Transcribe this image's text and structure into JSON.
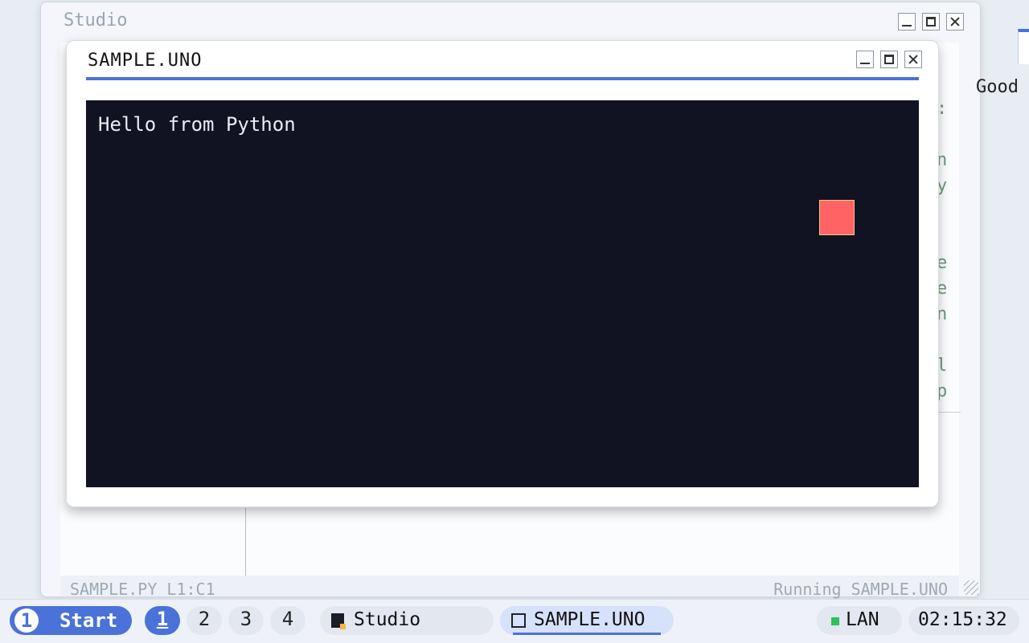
{
  "studio": {
    "title": "Studio",
    "peek_chars": [
      ":",
      "n",
      "y",
      "e",
      "e",
      "n",
      "l",
      "p"
    ],
    "status_left": "SAMPLE.PY L1:C1",
    "status_right": "Running SAMPLE.UNO"
  },
  "edge_window": {
    "text": "Good"
  },
  "uno": {
    "title": "SAMPLE.UNO",
    "canvas_text": "Hello from Python",
    "sprite_color": "#ff6363"
  },
  "taskbar": {
    "start_num": "1",
    "start_label": "Start",
    "workspaces": [
      "1",
      "2",
      "3",
      "4"
    ],
    "tasks": [
      "Studio",
      "SAMPLE.UNO"
    ],
    "network": "LAN",
    "clock": "02:15:32"
  },
  "colors": {
    "accent": "#4a72d8",
    "canvas": "#111322"
  }
}
